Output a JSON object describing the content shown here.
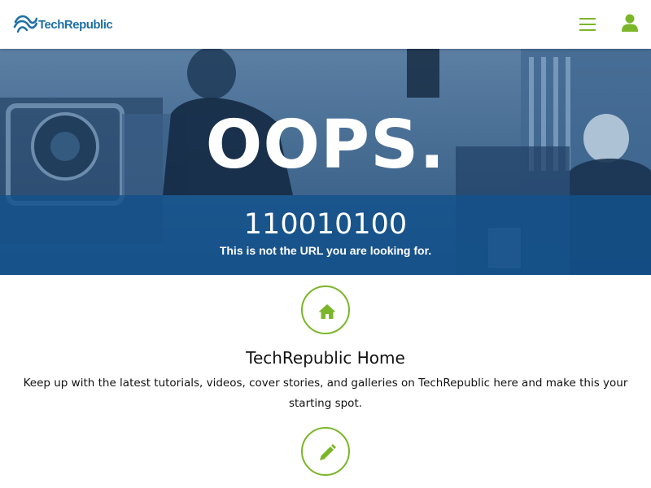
{
  "header": {
    "logo_text": "TechRepublic",
    "menu_icon": "hamburger-menu-icon",
    "user_icon": "user-icon",
    "accent_color": "#7bb62a",
    "brand_color": "#1f6fa5"
  },
  "hero": {
    "title": "OOPS.",
    "code": "110010100",
    "subtitle": "This is not the URL you are looking for.",
    "band_color": "#12528c"
  },
  "links": [
    {
      "icon": "home-icon",
      "title": "TechRepublic Home",
      "description": "Keep up with the latest tutorials, videos, cover stories, and galleries on TechRepublic here and make this your starting spot."
    },
    {
      "icon": "pencil-icon"
    }
  ]
}
